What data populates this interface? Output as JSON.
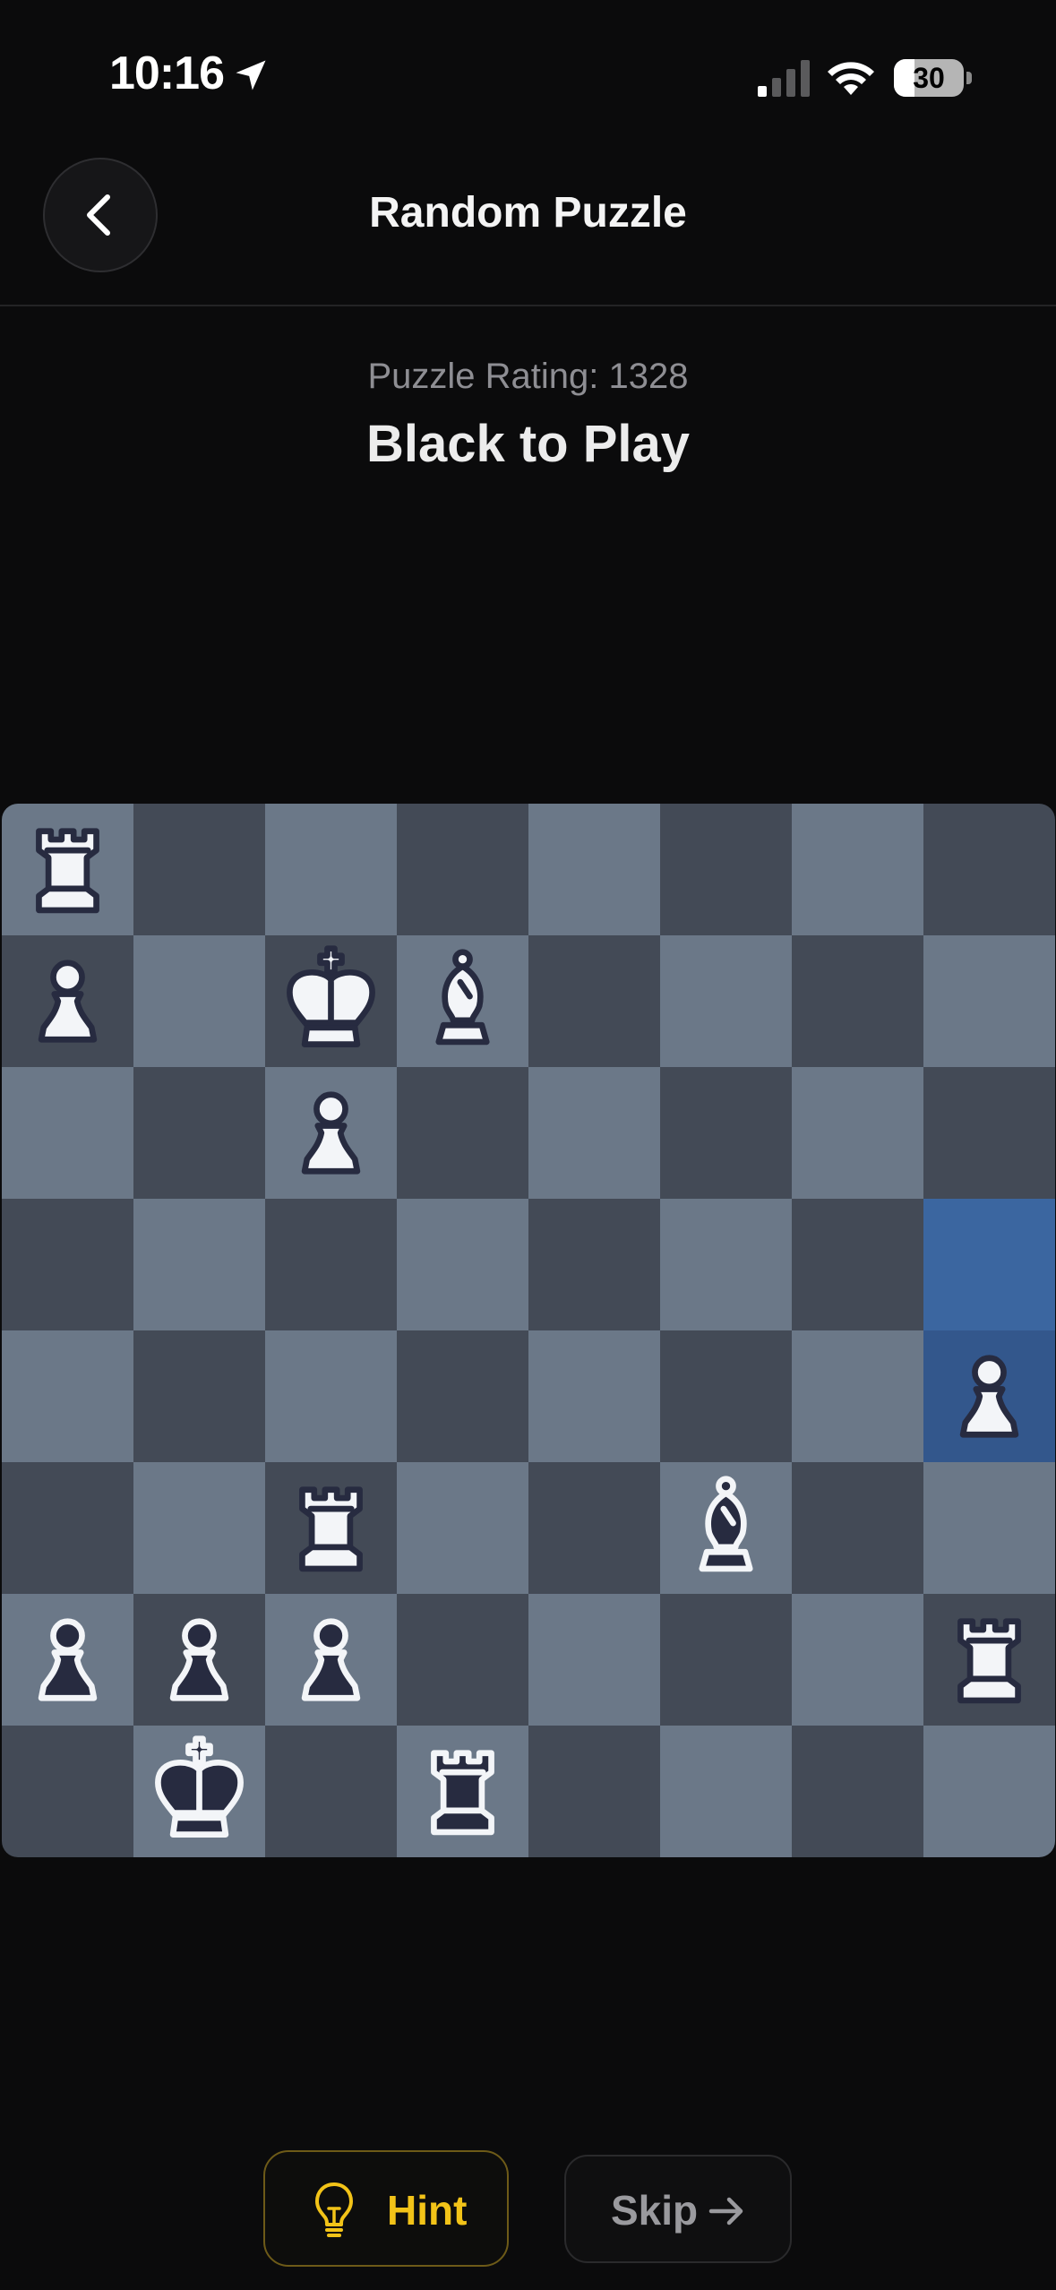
{
  "status_bar": {
    "time": "10:16",
    "battery_level": "30",
    "battery_fraction": 0.3,
    "signal_bars": 1
  },
  "header": {
    "title": "Random Puzzle",
    "back_icon": "chevron-left-icon"
  },
  "puzzle": {
    "rating_text": "Puzzle Rating: 1328",
    "to_play": "Black to Play"
  },
  "board": {
    "files": [
      "a",
      "b",
      "c",
      "d",
      "e",
      "f",
      "g",
      "h"
    ],
    "ranks": [
      8,
      7,
      6,
      5,
      4,
      3,
      2,
      1
    ],
    "colors": {
      "light": "#6b7888",
      "dark": "#434a56",
      "highlight_light": "#3b66a0",
      "highlight_dark": "#33578c",
      "white_piece": "#f3f5f8",
      "black_piece": "#272b40"
    },
    "highlighted_squares": [
      "h5",
      "h4"
    ],
    "pieces": [
      {
        "square": "a8",
        "type": "rook",
        "color": "white"
      },
      {
        "square": "a7",
        "type": "pawn",
        "color": "white"
      },
      {
        "square": "c7",
        "type": "king",
        "color": "white"
      },
      {
        "square": "d7",
        "type": "bishop",
        "color": "white"
      },
      {
        "square": "c6",
        "type": "pawn",
        "color": "white"
      },
      {
        "square": "h4",
        "type": "pawn",
        "color": "white"
      },
      {
        "square": "c3",
        "type": "rook",
        "color": "white"
      },
      {
        "square": "f3",
        "type": "bishop",
        "color": "black"
      },
      {
        "square": "a2",
        "type": "pawn",
        "color": "black"
      },
      {
        "square": "b2",
        "type": "pawn",
        "color": "black"
      },
      {
        "square": "c2",
        "type": "pawn",
        "color": "black"
      },
      {
        "square": "h2",
        "type": "rook",
        "color": "white"
      },
      {
        "square": "b1",
        "type": "king",
        "color": "black"
      },
      {
        "square": "d1",
        "type": "rook",
        "color": "black"
      }
    ]
  },
  "actions": {
    "hint_label": "Hint",
    "hint_icon": "lightbulb-icon",
    "hint_color": "#f2c318",
    "skip_label": "Skip",
    "skip_icon": "arrow-right-icon"
  }
}
